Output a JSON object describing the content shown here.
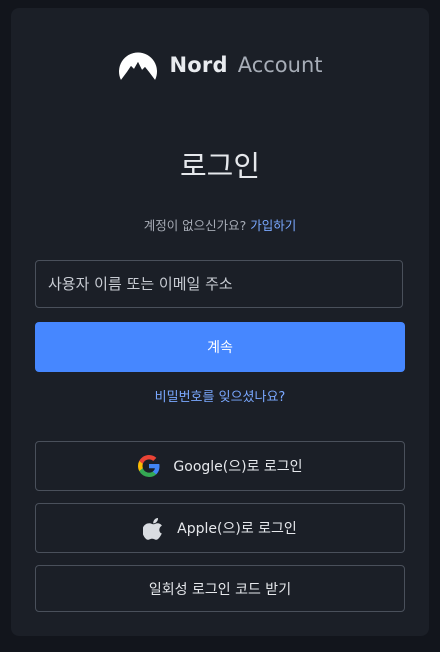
{
  "brand": {
    "logo_icon": "nord-mountain-logo-icon",
    "name": "Nord",
    "subtitle": "Account"
  },
  "login": {
    "title": "로그인",
    "signup_prompt": "계정이 없으신가요?",
    "signup_link": "가입하기",
    "username_placeholder": "사용자 이름 또는 이메일 주소",
    "username_value": "",
    "continue_label": "계속",
    "forgot_label": "비밀번호를 잊으셨나요?",
    "google_label": "Google(으)로 로그인",
    "google_icon": "google-icon",
    "apple_label": "Apple(으)로 로그인",
    "apple_icon": "apple-icon",
    "otp_label": "일회성 로그인 코드 받기"
  },
  "colors": {
    "background": "#12151c",
    "card": "#1b1f27",
    "accent": "#4687ff",
    "link": "#7aa8ff",
    "border": "#4a505b"
  }
}
